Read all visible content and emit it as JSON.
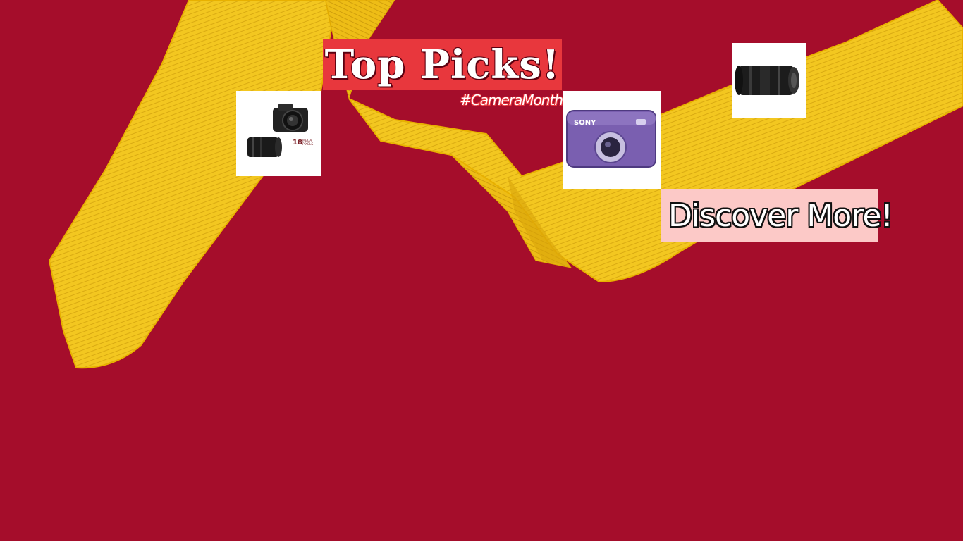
{
  "promo": {
    "title": "Top Picks!",
    "hashtag": "#CameraMonth",
    "cta_label": "Discover More!"
  },
  "products": {
    "dslr_kit": {
      "badge_line1": "18",
      "badge_line2": "MEGA",
      "badge_line3": "PIXELS"
    },
    "compact": {
      "brand": "SONY"
    }
  },
  "colors": {
    "background": "#a50d2b",
    "ribbon": "#f2c51c",
    "title_bg": "#e8373d",
    "cta_bg": "#fcc9c7"
  }
}
